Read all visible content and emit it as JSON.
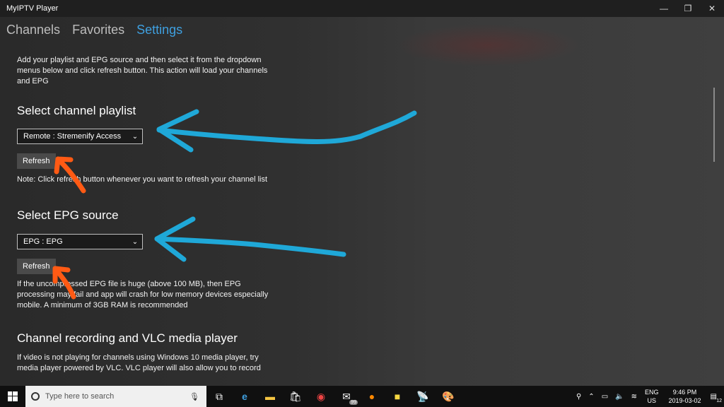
{
  "window": {
    "title": "MyIPTV Player",
    "minimize": "—",
    "restore": "❐",
    "close": "✕"
  },
  "tabs": [
    {
      "label": "Channels",
      "active": false
    },
    {
      "label": "Favorites",
      "active": false
    },
    {
      "label": "Settings",
      "active": true
    }
  ],
  "settings": {
    "intro": "Add your playlist and EPG source and then select it from the dropdown menus below and click refresh button. This action will load your channels and EPG",
    "playlist": {
      "title": "Select channel playlist",
      "selected": "Remote : Stremenify Access",
      "refresh_label": "Refresh",
      "note": "Note: Click refresh button whenever you want to refresh your channel list"
    },
    "epg": {
      "title": "Select EPG source",
      "selected": "EPG : EPG",
      "refresh_label": "Refresh",
      "note": "If the uncompressed EPG file is huge (above 100 MB), then EPG processing may fail and app will crash for low memory devices especially mobile. A minimum of 3GB RAM is recommended"
    },
    "vlc": {
      "title": "Channel recording and VLC media player",
      "note": "If video is not playing for channels using Windows 10 media player, try media player powered by VLC. VLC player will also allow you to record"
    }
  },
  "taskbar": {
    "search_placeholder": "Type here to search",
    "mail_badge": "99",
    "language": "ENG",
    "region": "US",
    "time": "9:46 PM",
    "date": "2019-03-02",
    "notification_count": "12"
  },
  "colors": {
    "accent": "#3fa0e0",
    "arrow_blue": "#1fa8d8",
    "arrow_orange": "#ff5a14"
  }
}
